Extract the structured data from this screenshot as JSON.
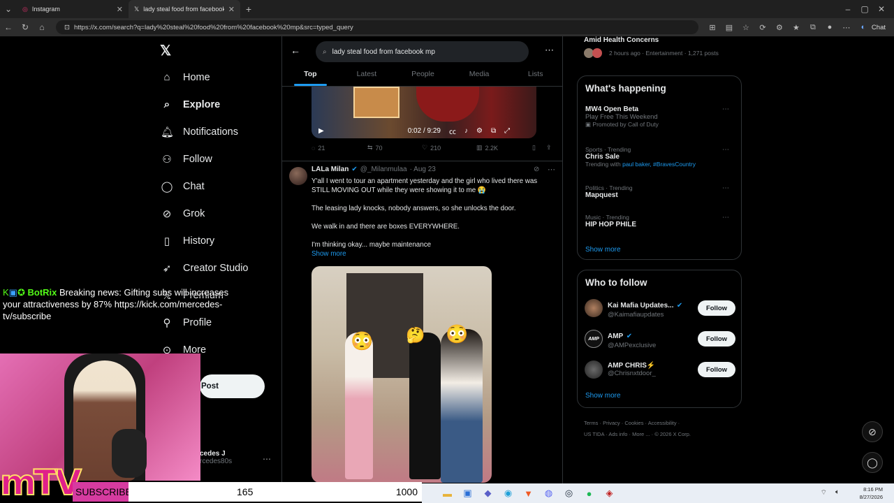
{
  "browser": {
    "tabs": [
      {
        "label": "Instagram",
        "icon": "instagram-icon"
      },
      {
        "label": "lady steal food from facebook mp",
        "icon": "x-logo-icon"
      }
    ],
    "url": "https://x.com/search?q=lady%20steal%20food%20from%20facebook%20mp&src=typed_query",
    "chat_label": "Chat"
  },
  "nav": {
    "items": [
      {
        "label": "Home",
        "icon": "home-icon"
      },
      {
        "label": "Explore",
        "icon": "search-icon"
      },
      {
        "label": "Notifications",
        "icon": "bell-icon"
      },
      {
        "label": "Follow",
        "icon": "add-person-icon"
      },
      {
        "label": "Chat",
        "icon": "chat-bubble-icon"
      },
      {
        "label": "Grok",
        "icon": "grok-icon"
      },
      {
        "label": "History",
        "icon": "bookmark-icon"
      },
      {
        "label": "Creator Studio",
        "icon": "rocket-icon"
      },
      {
        "label": "Premium",
        "icon": "x-logo-icon"
      },
      {
        "label": "Profile",
        "icon": "person-icon"
      },
      {
        "label": "More",
        "icon": "more-circle-icon"
      }
    ],
    "post_label": "Post",
    "account_name": "cedes J",
    "account_handle": "rcedes80s"
  },
  "search": {
    "query": "lady steal food from facebook mp",
    "tabs": [
      "Top",
      "Latest",
      "People",
      "Media",
      "Lists"
    ],
    "active_tab": "Top"
  },
  "tweet1": {
    "time": "0:02 / 9:29",
    "replies": "21",
    "reposts": "70",
    "likes": "210",
    "views": "2.2K"
  },
  "tweet2": {
    "name": "LALa Milan",
    "handle": "@_Milanmulaa",
    "date": "· Aug 23",
    "lines": [
      "Y'all I went to tour an apartment yesterday and the girl who lived there was STILL MOVING OUT while they were showing it to me 😭",
      "The leasing lady knocks, nobody answers, so she unlocks the door.",
      "We walk in and there are boxes EVERYWHERE.",
      "I'm thinking okay... maybe maintenance"
    ],
    "show_more": "Show more"
  },
  "right": {
    "top_trend_title": "Amid Health Concerns",
    "top_trend_meta": "2 hours ago · Entertainment · 1,271 posts",
    "whats_happening": "What's happening",
    "trends": [
      {
        "cat": "",
        "name": "MW4 Open Beta",
        "sub": "Play Free This Weekend",
        "extra": "Promoted by Call of Duty"
      },
      {
        "cat": "Sports · Trending",
        "name": "Chris Sale",
        "sub": "Trending with",
        "extra": "paul baker, #BravesCountry"
      },
      {
        "cat": "Politics · Trending",
        "name": "Mapquest",
        "sub": "",
        "extra": ""
      },
      {
        "cat": "Music · Trending",
        "name": "HIP HOP PHILE",
        "sub": "",
        "extra": ""
      }
    ],
    "show_more": "Show more",
    "who_to_follow": "Who to follow",
    "follow_suggestions": [
      {
        "name": "Kai Mafia Updates...",
        "handle": "@Kaimafiaupdates",
        "button": "Follow"
      },
      {
        "name": "AMP",
        "handle": "@AMPexclusive",
        "button": "Follow"
      },
      {
        "name": "AMP CHRIS⚡",
        "handle": "@Chrisnxtdoor_",
        "button": "Follow"
      }
    ],
    "footer": [
      "Terms",
      "Privacy",
      "Cookies",
      "Accessibility",
      "US TIDA",
      "Ads info",
      "More ...",
      "© 2026 X Corp."
    ]
  },
  "overlay": {
    "botrix_name": "BotRix",
    "botrix_msg": "Breaking news: Gifting subs will increases your attractiveness by 87% https://kick.com/mercedes-tv/subscribe",
    "logo_text": "mTV",
    "subs_label": "SUBSCRIBERS",
    "subs_current": "165",
    "subs_goal": "1000"
  },
  "taskbar": {
    "time": "8:16 PM",
    "date": "8/27/2026"
  }
}
